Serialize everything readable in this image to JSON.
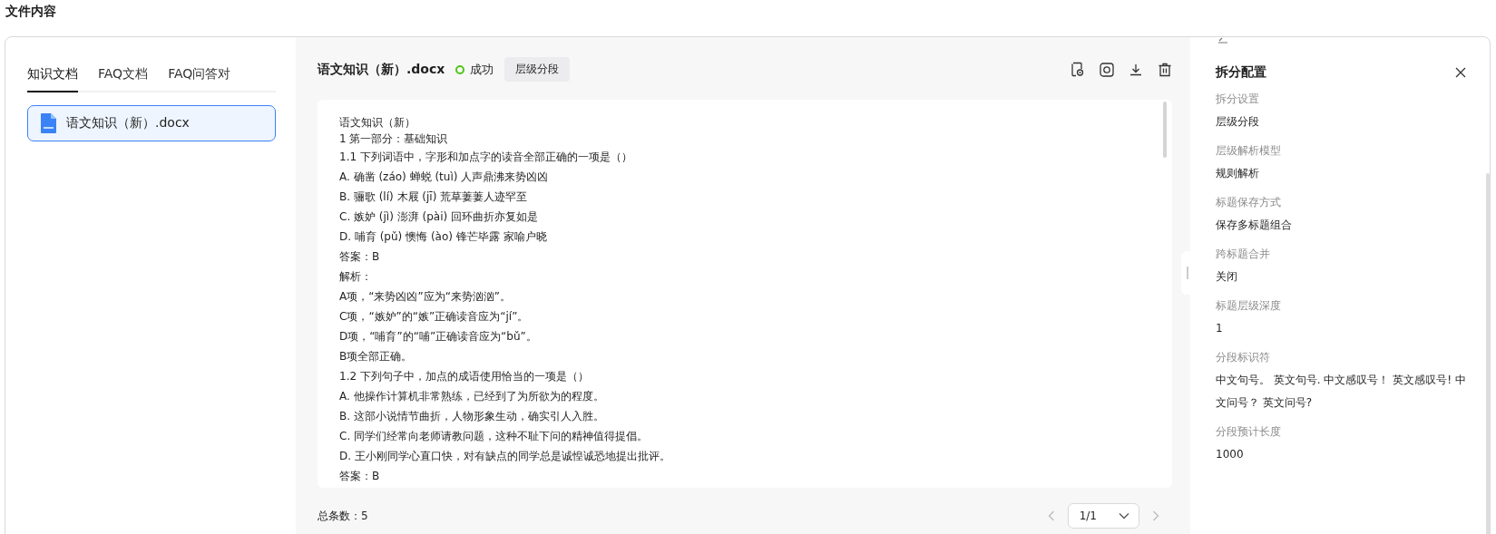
{
  "page_title": "文件内容",
  "tabs": [
    {
      "label": "知识文档",
      "selected": true
    },
    {
      "label": "FAQ文档",
      "selected": false
    },
    {
      "label": "FAQ问答对",
      "selected": false
    }
  ],
  "files": [
    {
      "name": "语文知识（新）.docx",
      "selected": true
    }
  ],
  "document": {
    "title": "语文知识（新）.docx",
    "status": {
      "label": "成功",
      "kind": "success"
    },
    "tag": "层级分段",
    "lines": [
      "语文知识（新）",
      "1 第一部分：基础知识",
      "1.1 下列词语中，字形和加点字的读音全部正确的一项是（）",
      "A. 确凿 (záo) 蝉蜕 (tuì) 人声鼎沸来势凶凶",
      "B. 骊歌 (lí) 木屐 (jī) 荒草萋萋人迹罕至",
      "C. 嫉妒 (jì) 澎湃 (pài) 回环曲折亦复如是",
      "D. 哺育 (pǔ) 懊悔 (ào) 锋芒毕露 家喻户晓",
      "答案：B",
      "解析：",
      "A项，“来势凶凶”应为“来势汹汹”。",
      "C项，“嫉妒”的“嫉”正确读音应为“jí”。",
      "D项，“哺育”的“哺”正确读音应为“bǔ”。",
      "B项全部正确。",
      "1.2 下列句子中，加点的成语使用恰当的一项是（）",
      "A. 他操作计算机非常熟练，已经到了为所欲为的程度。",
      "B. 这部小说情节曲折，人物形象生动，确实引人入胜。",
      "C. 同学们经常向老师请教问题，这种不耻下问的精神值得提倡。",
      "D. 王小刚同学心直口快，对有缺点的同学总是诚惶诚恐地提出批评。",
      "答案：B"
    ],
    "total": "总条数：5",
    "page": "1/1"
  },
  "config": {
    "title": "拆分配置",
    "fields": [
      {
        "label": "拆分设置",
        "value": "层级分段"
      },
      {
        "label": "层级解析模型",
        "value": "规则解析"
      },
      {
        "label": "标题保存方式",
        "value": "保存多标题组合"
      },
      {
        "label": "跨标题合并",
        "value": "关闭"
      },
      {
        "label": "标题层级深度",
        "value": "1"
      },
      {
        "label": "分段标识符",
        "value": "中文句号。 英文句号. 中文感叹号！ 英文感叹号! 中文问号？ 英文问号?"
      },
      {
        "label": "分段预计长度",
        "value": "1000"
      }
    ]
  }
}
